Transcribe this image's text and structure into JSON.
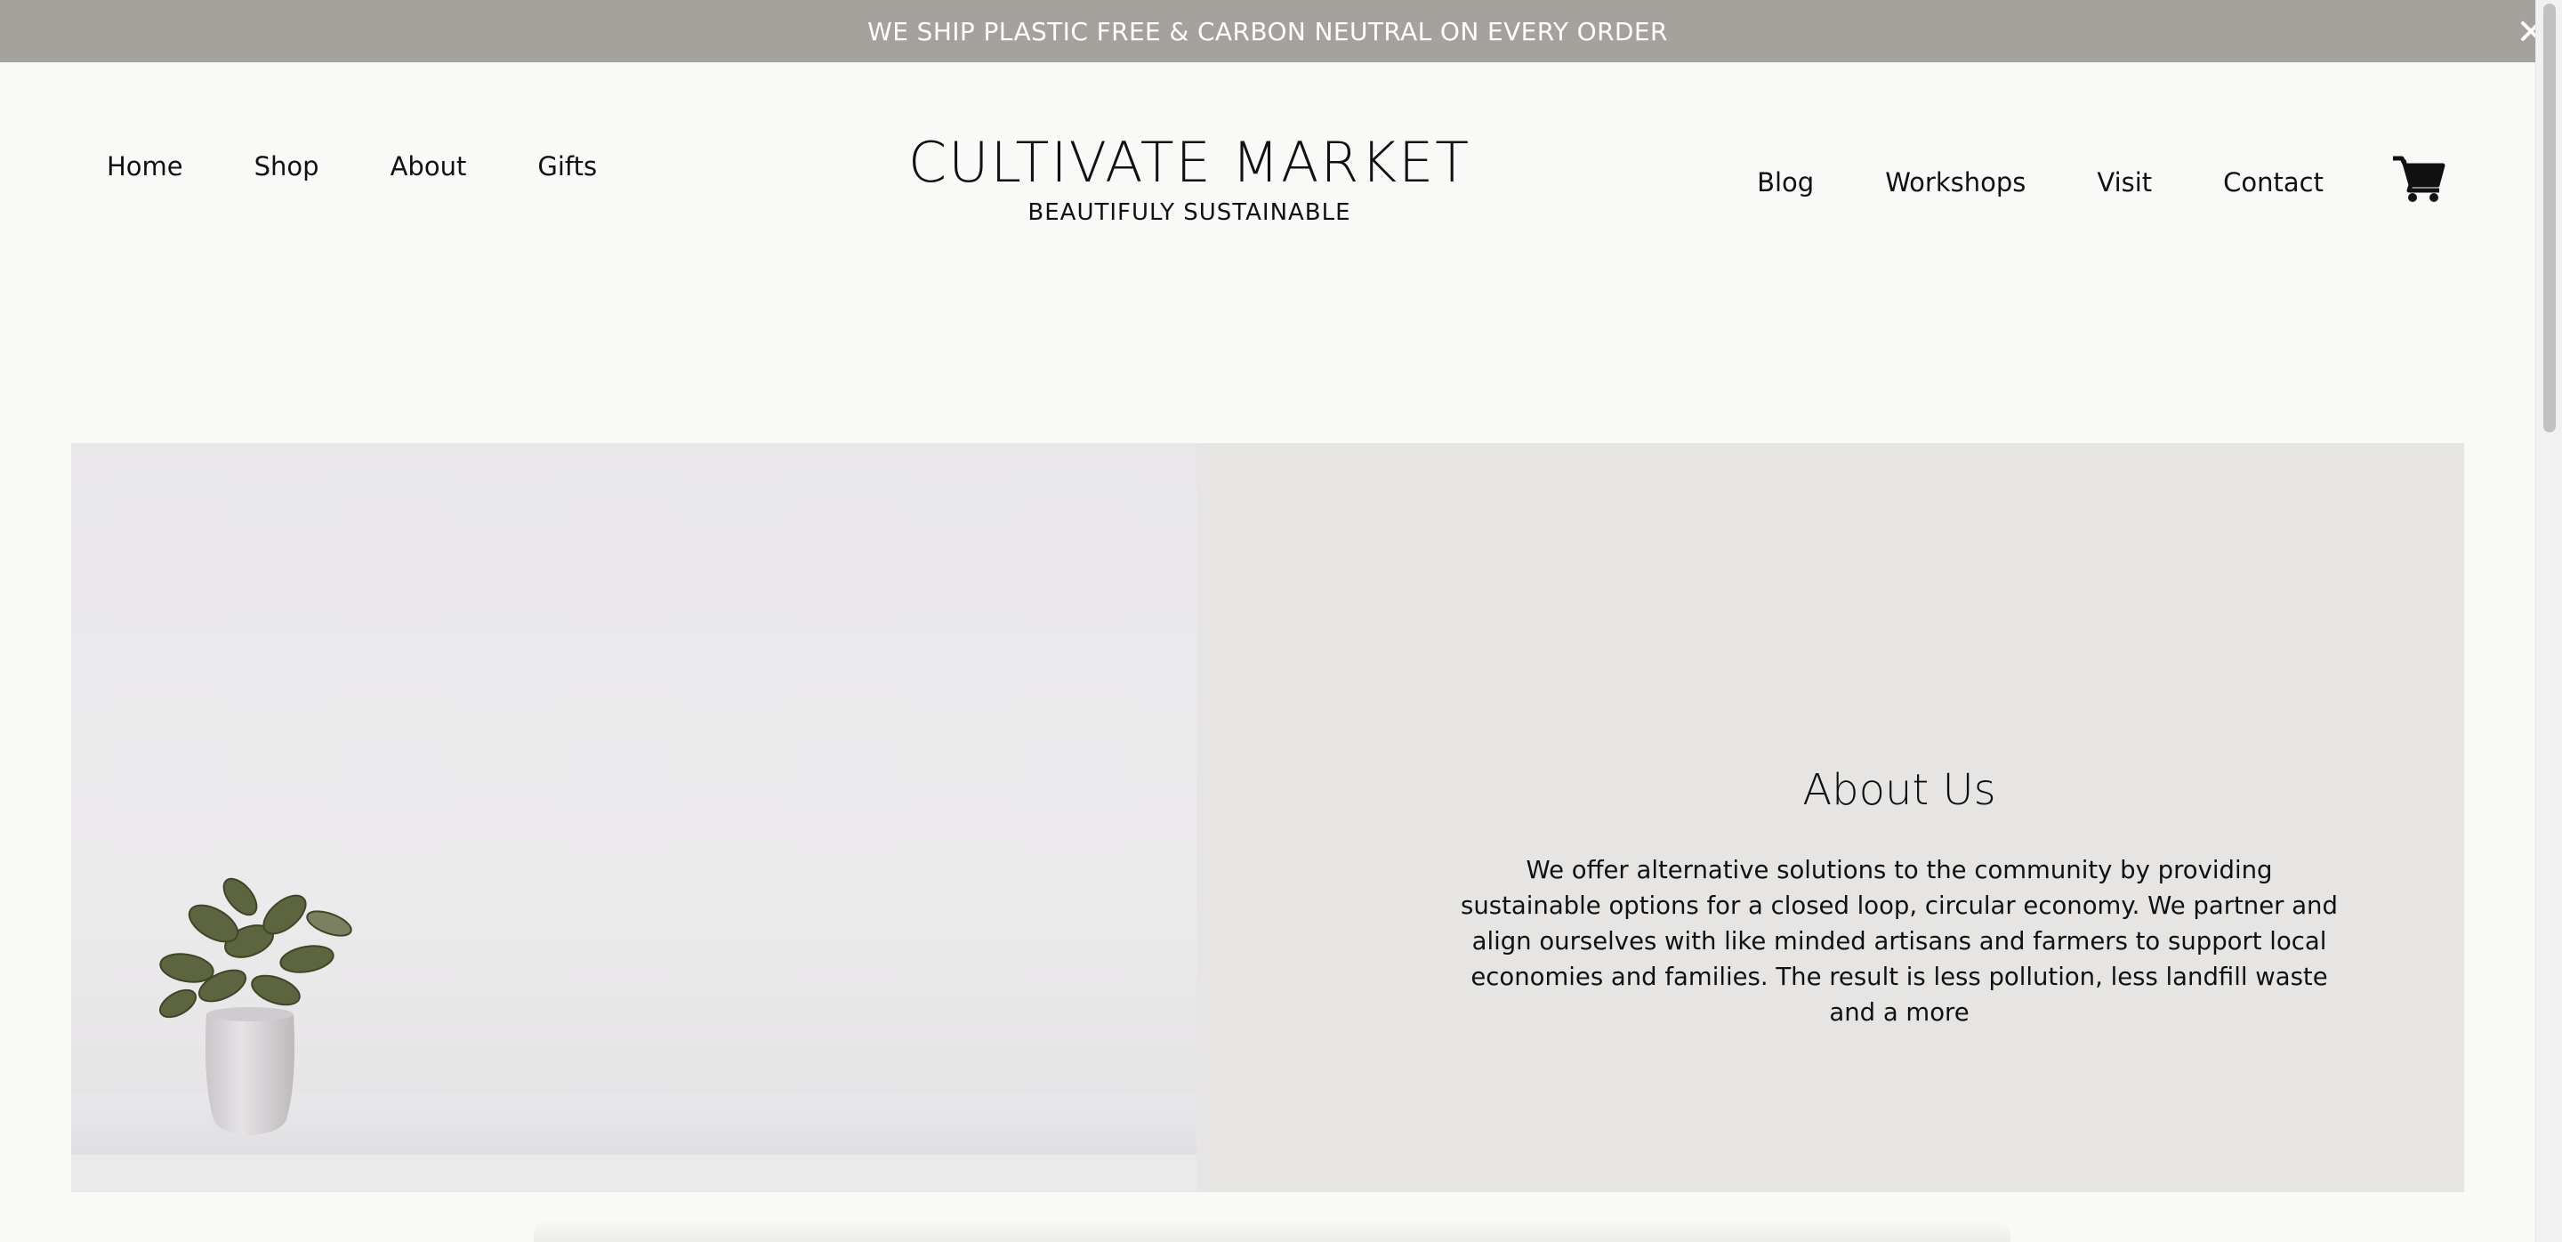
{
  "announcement": {
    "text": "WE SHIP PLASTIC FREE & CARBON NEUTRAL ON EVERY ORDER",
    "close_icon": "close-icon"
  },
  "nav_left": [
    {
      "label": "Home"
    },
    {
      "label": "Shop"
    },
    {
      "label": "About"
    },
    {
      "label": "Gifts"
    }
  ],
  "brand": {
    "title": "CULTIVATE MARKET",
    "subtitle": "BEAUTIFULY SUSTAINABLE"
  },
  "nav_right": [
    {
      "label": "Blog"
    },
    {
      "label": "Workshops"
    },
    {
      "label": "Visit"
    },
    {
      "label": "Contact"
    }
  ],
  "cart": {
    "icon": "cart-icon"
  },
  "about": {
    "title": "About Us",
    "body": "We offer alternative solutions to the community by providing sustainable options for a closed loop, circular economy. We partner and align ourselves with like minded artisans and farmers to support local economies and families. The result is less pollution, less landfill waste and a more"
  },
  "colors": {
    "announcement_bg": "#a5a19c",
    "page_bg": "#f9f9f7",
    "hero_bg": "#e6e5e3",
    "text": "#111111"
  }
}
